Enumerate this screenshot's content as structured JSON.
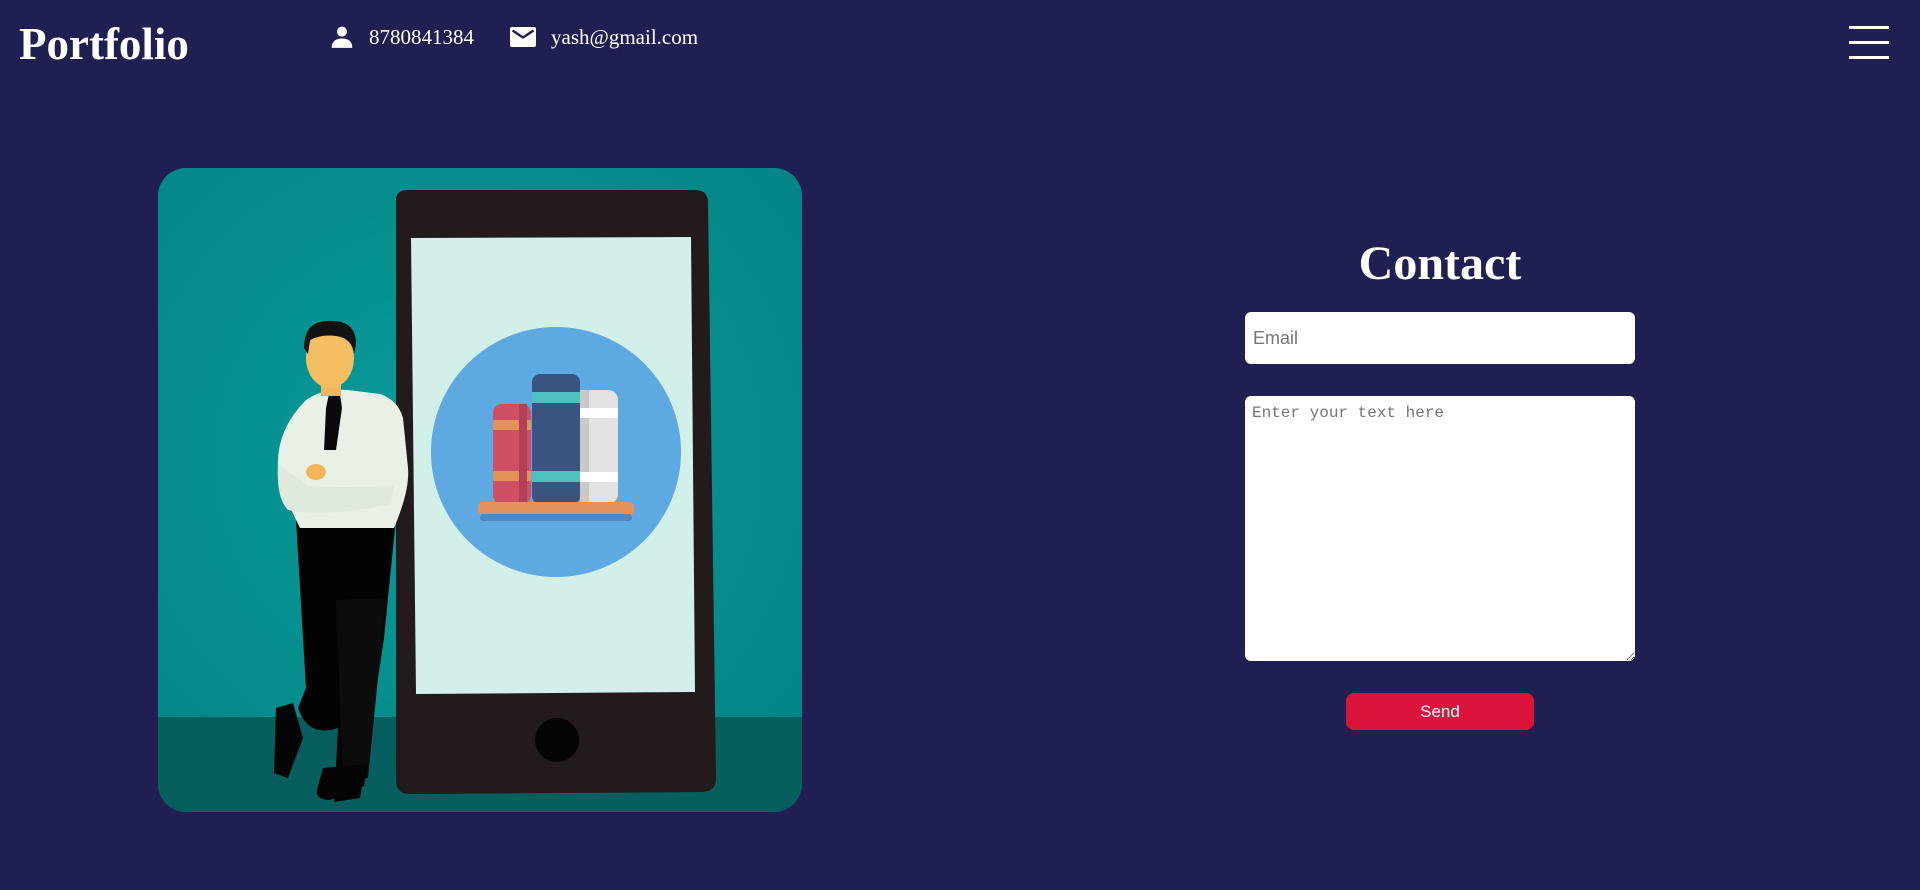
{
  "header": {
    "brand": "Portfolio",
    "phone": "8780841384",
    "email": "yash@gmail.com",
    "icons": {
      "phone": "person-icon",
      "email": "mail-icon",
      "menu": "hamburger-menu-icon"
    }
  },
  "illustration": {
    "subject": "businessman-leaning-on-phone-with-books"
  },
  "contact": {
    "title": "Contact",
    "email_placeholder": "Email",
    "message_placeholder": "Enter your text here",
    "send_label": "Send"
  },
  "colors": {
    "background": "#1f1f52",
    "accent": "#dc143c",
    "illustration_bg": "#028c8c"
  }
}
